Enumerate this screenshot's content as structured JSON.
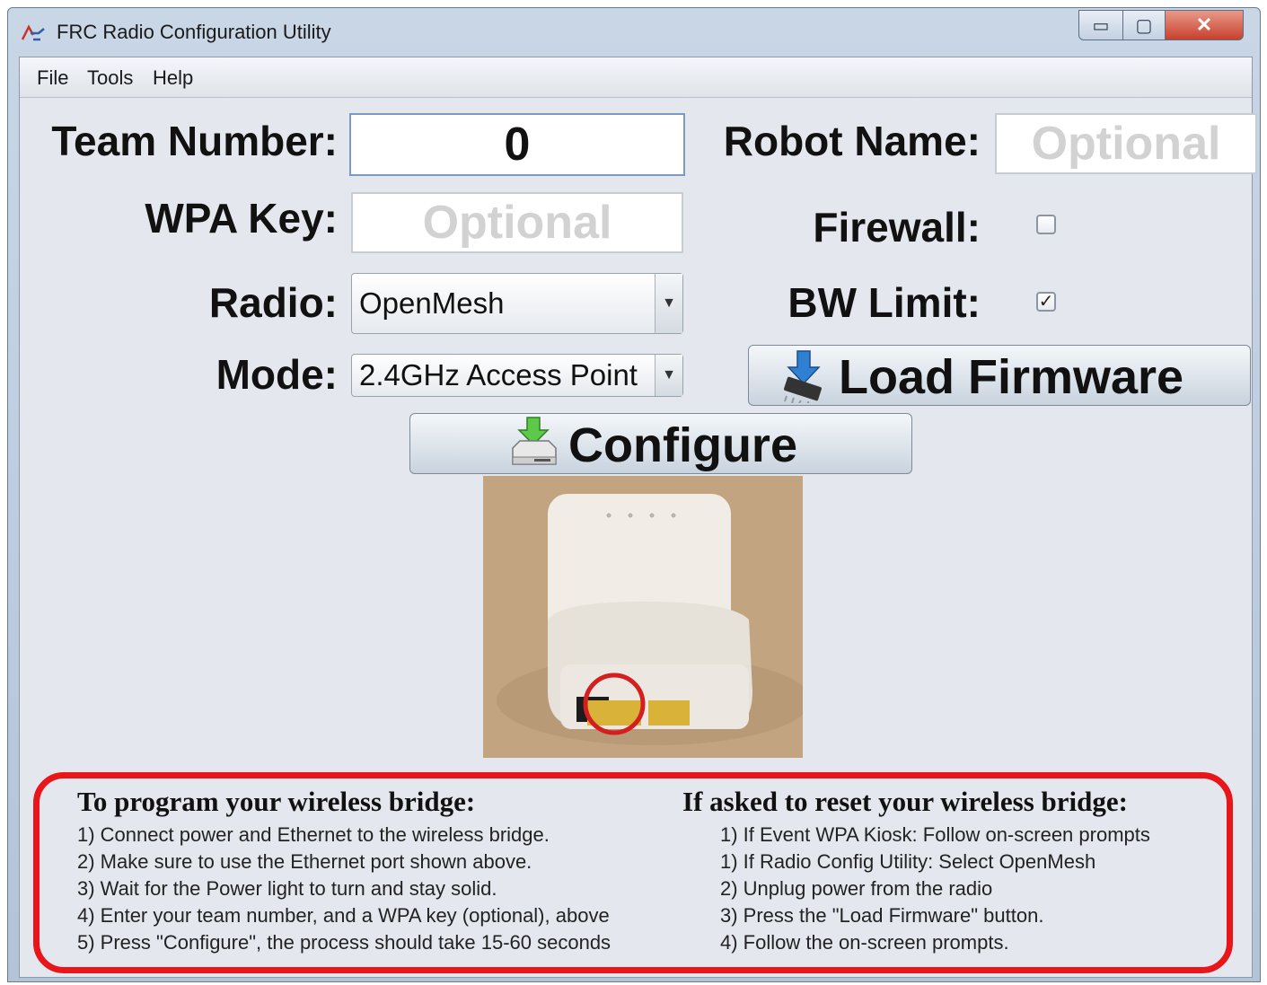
{
  "window": {
    "title": "FRC Radio Configuration Utility",
    "controls": {
      "minimize": "▭",
      "maximize": "▢",
      "close": "✕"
    }
  },
  "menu": [
    "File",
    "Tools",
    "Help"
  ],
  "form": {
    "team_number_label": "Team Number:",
    "team_number_value": "0",
    "robot_name_label": "Robot Name:",
    "robot_name_placeholder": "Optional",
    "wpa_key_label": "WPA Key:",
    "wpa_key_placeholder": "Optional",
    "firewall_label": "Firewall:",
    "firewall_checked": false,
    "radio_label": "Radio:",
    "radio_value": "OpenMesh",
    "bw_limit_label": "BW Limit:",
    "bw_limit_checked": true,
    "mode_label": "Mode:",
    "mode_value": "2.4GHz Access Point"
  },
  "buttons": {
    "load_firmware": "Load Firmware",
    "configure": "Configure"
  },
  "icons": {
    "app": "frc-logo-icon",
    "load_firmware": "chip-download-icon",
    "configure": "drive-download-icon",
    "dropdown": "chevron-down-icon"
  },
  "instructions": {
    "program_title": "To program your wireless bridge:",
    "program_steps": [
      "1) Connect power and Ethernet to the wireless bridge.",
      "2) Make sure to use the Ethernet port shown above.",
      "3) Wait for the Power light to turn and stay solid.",
      "4) Enter your team number, and a WPA key (optional), above",
      "5) Press \"Configure\", the process should take 15-60 seconds"
    ],
    "reset_title": "If asked to reset your wireless bridge:",
    "reset_steps": [
      "1) If Event WPA Kiosk: Follow on-screen prompts",
      "1) If Radio Config Utility: Select OpenMesh",
      "2) Unplug power from the radio",
      "3) Press the \"Load Firmware\" button.",
      "4) Follow the on-screen prompts."
    ]
  },
  "colors": {
    "highlight_border": "#e8161b",
    "client_bg": "#e4e8ee",
    "title_bg": "#c3d1e3"
  }
}
